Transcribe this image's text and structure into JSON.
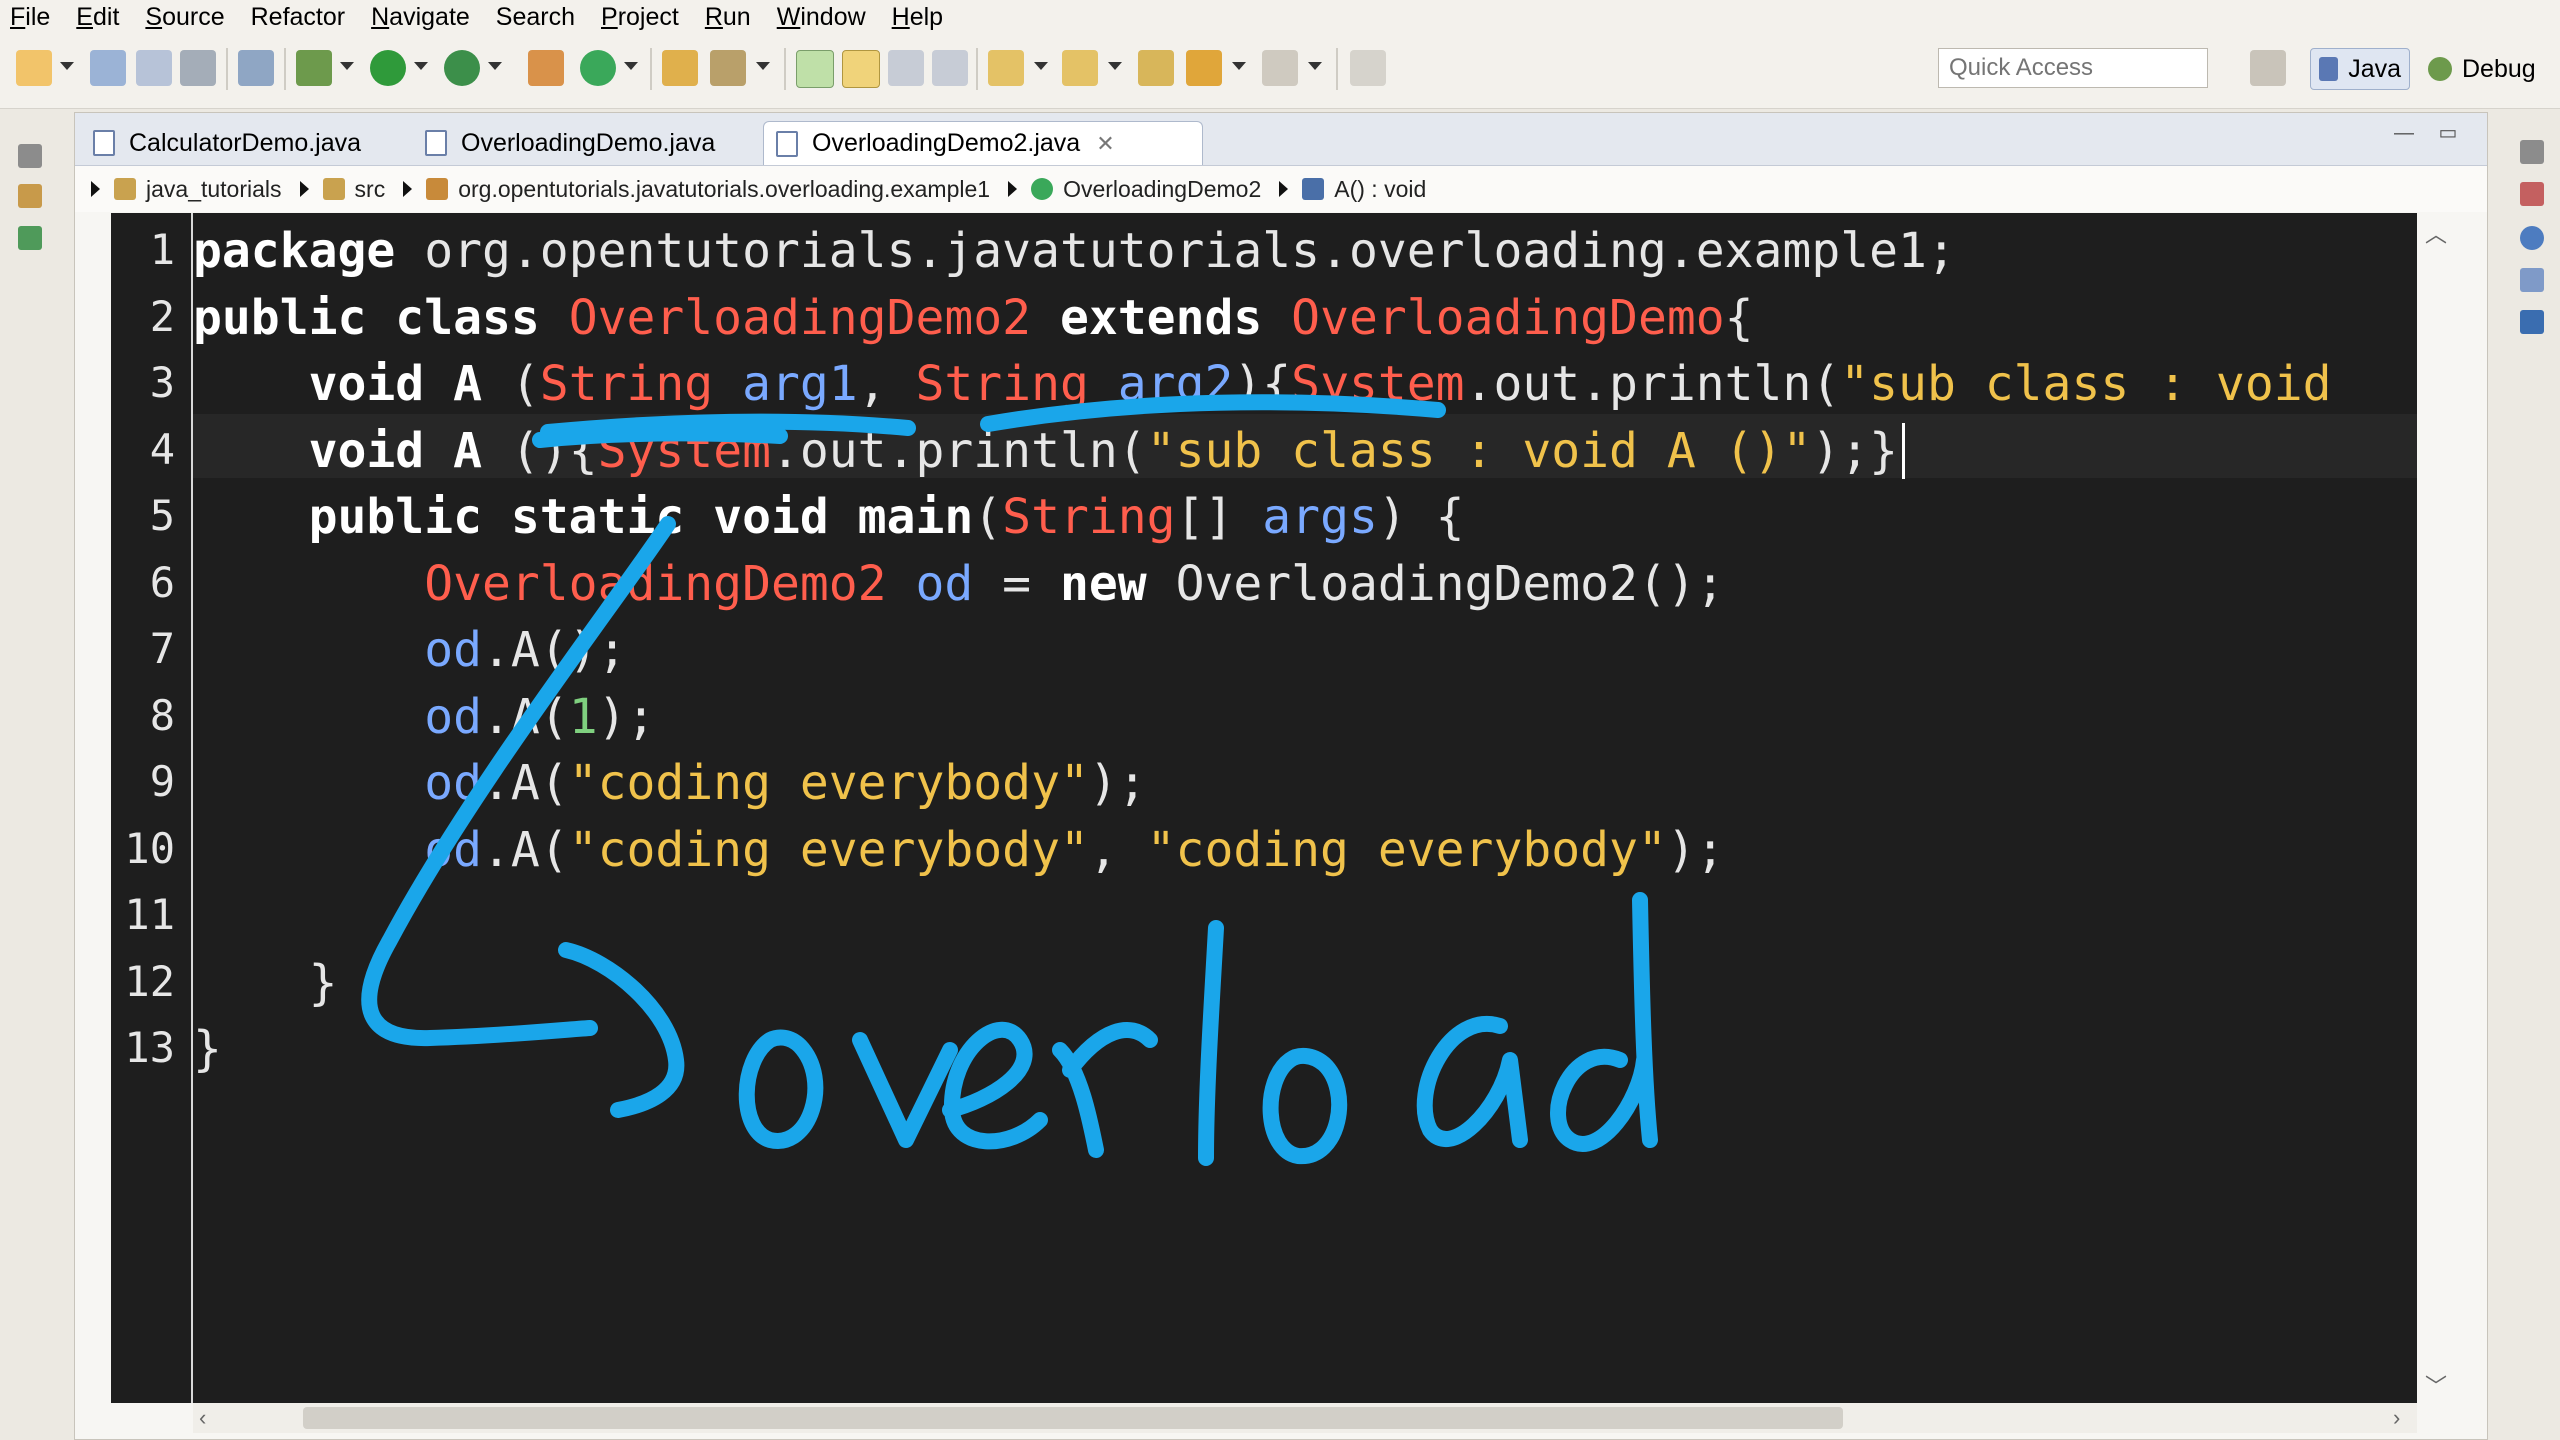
{
  "menu": [
    {
      "label": "File",
      "u": "F",
      "rest": "ile"
    },
    {
      "label": "Edit",
      "u": "E",
      "rest": "dit"
    },
    {
      "label": "Source",
      "u": "S",
      "rest": "ource"
    },
    {
      "label": "Refactor",
      "u": "",
      "rest": "Refactor"
    },
    {
      "label": "Navigate",
      "u": "N",
      "rest": "avigate"
    },
    {
      "label": "Search",
      "u": "",
      "rest": "Search"
    },
    {
      "label": "Project",
      "u": "P",
      "rest": "roject"
    },
    {
      "label": "Run",
      "u": "R",
      "rest": "un"
    },
    {
      "label": "Window",
      "u": "W",
      "rest": "indow"
    },
    {
      "label": "Help",
      "u": "H",
      "rest": "elp"
    }
  ],
  "toolbar": {
    "quick_access_placeholder": "Quick Access",
    "perspective_java": "Java",
    "perspective_debug": "Debug"
  },
  "tabs": [
    {
      "label": "CalculatorDemo.java"
    },
    {
      "label": "OverloadingDemo.java"
    },
    {
      "label": "OverloadingDemo2.java",
      "active": true
    }
  ],
  "breadcrumb": {
    "project": "java_tutorials",
    "folder": "src",
    "package": "org.opentutorials.javatutorials.overloading.example1",
    "class": "OverloadingDemo2",
    "method": "A() : void"
  },
  "code": {
    "line_numbers": [
      "1",
      "2",
      "3",
      "4",
      "5",
      "6",
      "7",
      "8",
      "9",
      "10",
      "11",
      "12",
      "13"
    ],
    "lines": [
      [
        {
          "t": "kw",
          "v": "package"
        },
        {
          "t": "pl",
          "v": " org.opentutorials.javatutorials.overloading.example1;"
        }
      ],
      [
        {
          "t": "kw",
          "v": "public class"
        },
        {
          "t": "pl",
          "v": " "
        },
        {
          "t": "ty",
          "v": "OverloadingDemo2"
        },
        {
          "t": "pl",
          "v": " "
        },
        {
          "t": "kw",
          "v": "extends"
        },
        {
          "t": "pl",
          "v": " "
        },
        {
          "t": "ty",
          "v": "OverloadingDemo"
        },
        {
          "t": "pl",
          "v": "{"
        }
      ],
      [
        {
          "t": "pl",
          "v": "    "
        },
        {
          "t": "kw",
          "v": "void"
        },
        {
          "t": "pl",
          "v": " "
        },
        {
          "t": "kw",
          "v": "A"
        },
        {
          "t": "pl",
          "v": " ("
        },
        {
          "t": "ty",
          "v": "String"
        },
        {
          "t": "pl",
          "v": " "
        },
        {
          "t": "vr",
          "v": "arg1"
        },
        {
          "t": "pl",
          "v": ", "
        },
        {
          "t": "ty",
          "v": "String"
        },
        {
          "t": "pl",
          "v": " "
        },
        {
          "t": "vr",
          "v": "arg2"
        },
        {
          "t": "pl",
          "v": "){"
        },
        {
          "t": "ty",
          "v": "System"
        },
        {
          "t": "pl",
          "v": ".out.println("
        },
        {
          "t": "st",
          "v": "\"sub class : void"
        }
      ],
      [
        {
          "t": "pl",
          "v": "    "
        },
        {
          "t": "kw",
          "v": "void"
        },
        {
          "t": "pl",
          "v": " "
        },
        {
          "t": "kw",
          "v": "A"
        },
        {
          "t": "pl",
          "v": " (){"
        },
        {
          "t": "ty",
          "v": "System"
        },
        {
          "t": "pl",
          "v": ".out.println("
        },
        {
          "t": "st",
          "v": "\"sub class : void A ()\""
        },
        {
          "t": "pl",
          "v": ");}"
        }
      ],
      [
        {
          "t": "pl",
          "v": "    "
        },
        {
          "t": "kw",
          "v": "public static void"
        },
        {
          "t": "pl",
          "v": " "
        },
        {
          "t": "kw",
          "v": "main"
        },
        {
          "t": "pl",
          "v": "("
        },
        {
          "t": "ty",
          "v": "String"
        },
        {
          "t": "pl",
          "v": "[] "
        },
        {
          "t": "vr",
          "v": "args"
        },
        {
          "t": "pl",
          "v": ") {"
        }
      ],
      [
        {
          "t": "pl",
          "v": "        "
        },
        {
          "t": "ty",
          "v": "OverloadingDemo2"
        },
        {
          "t": "pl",
          "v": " "
        },
        {
          "t": "vr",
          "v": "od"
        },
        {
          "t": "pl",
          "v": " = "
        },
        {
          "t": "kw",
          "v": "new"
        },
        {
          "t": "pl",
          "v": " OverloadingDemo2();"
        }
      ],
      [
        {
          "t": "pl",
          "v": "        "
        },
        {
          "t": "vr",
          "v": "od"
        },
        {
          "t": "pl",
          "v": ".A();"
        }
      ],
      [
        {
          "t": "pl",
          "v": "        "
        },
        {
          "t": "vr",
          "v": "od"
        },
        {
          "t": "pl",
          "v": ".A("
        },
        {
          "t": "nm",
          "v": "1"
        },
        {
          "t": "pl",
          "v": ");"
        }
      ],
      [
        {
          "t": "pl",
          "v": "        "
        },
        {
          "t": "vr",
          "v": "od"
        },
        {
          "t": "pl",
          "v": ".A("
        },
        {
          "t": "st",
          "v": "\"coding everybody\""
        },
        {
          "t": "pl",
          "v": ");"
        }
      ],
      [
        {
          "t": "pl",
          "v": "        "
        },
        {
          "t": "vr",
          "v": "od"
        },
        {
          "t": "pl",
          "v": ".A("
        },
        {
          "t": "st",
          "v": "\"coding everybody\""
        },
        {
          "t": "pl",
          "v": ", "
        },
        {
          "t": "st",
          "v": "\"coding everybody\""
        },
        {
          "t": "pl",
          "v": ");"
        }
      ],
      [
        {
          "t": "pl",
          "v": ""
        }
      ],
      [
        {
          "t": "pl",
          "v": "    }"
        }
      ],
      [
        {
          "t": "pl",
          "v": "}"
        }
      ]
    ]
  },
  "annotation": {
    "handwritten_text": "overload",
    "ink_color": "#1aa6ea"
  },
  "colors": {
    "editor_bg": "#1e1e1e",
    "keyword": "#ffffff",
    "type": "#ff5e4d",
    "variable": "#7aa9ff",
    "string": "#f0c24b",
    "number": "#7fd07f"
  }
}
